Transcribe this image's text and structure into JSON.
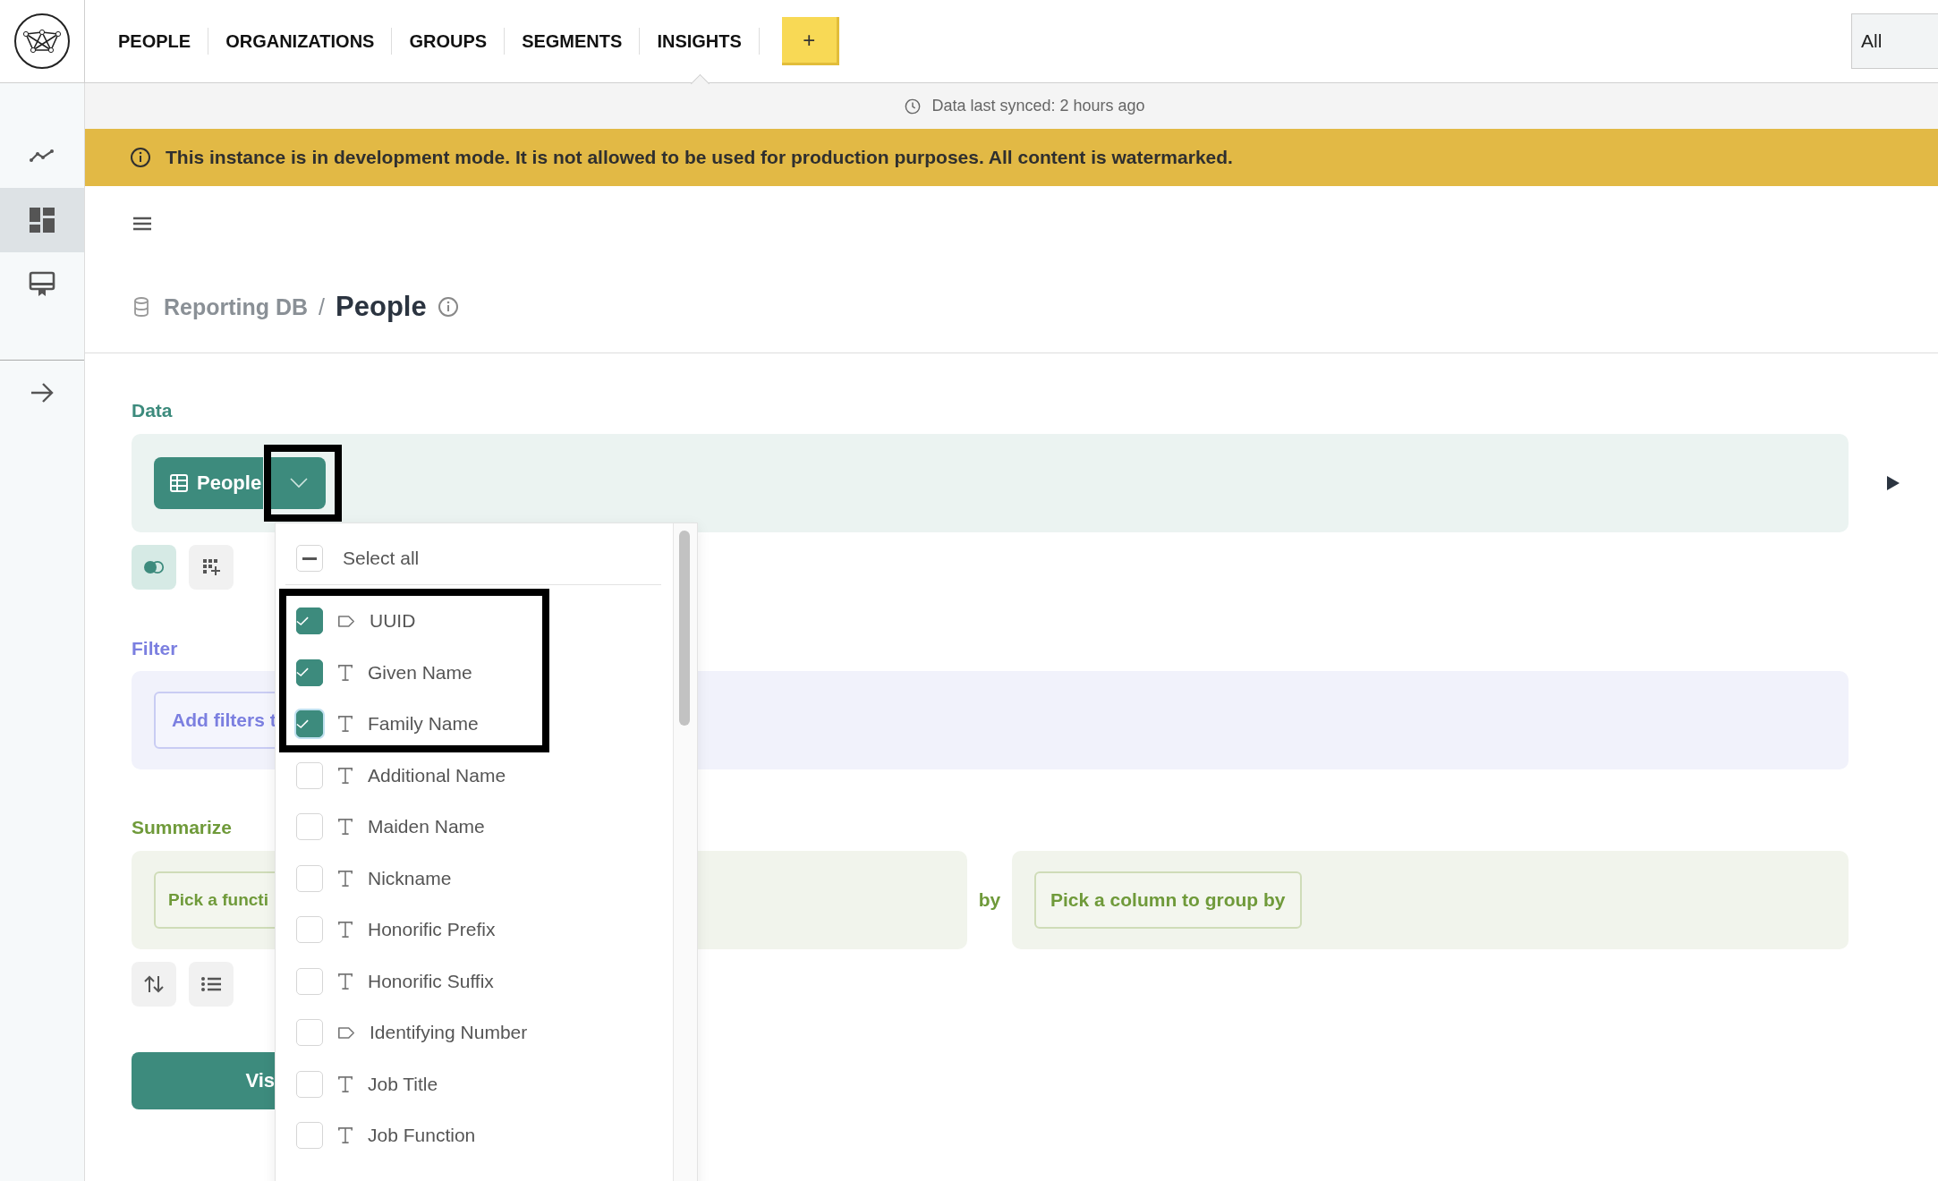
{
  "nav": {
    "tabs": [
      {
        "label": "PEOPLE",
        "selected": false
      },
      {
        "label": "ORGANIZATIONS",
        "selected": false
      },
      {
        "label": "GROUPS",
        "selected": false
      },
      {
        "label": "SEGMENTS",
        "selected": false
      },
      {
        "label": "INSIGHTS",
        "selected": true
      }
    ],
    "add_button": "+",
    "scope_select": {
      "value": "All"
    }
  },
  "sidebar": {
    "items": [
      {
        "kind": "chart",
        "selected": false
      },
      {
        "kind": "dashboard",
        "selected": true
      },
      {
        "kind": "presentation",
        "selected": false
      }
    ]
  },
  "sync_status": "Data last synced: 2 hours ago",
  "banner": "This instance is in development mode. It is not allowed to be used for production purposes. All content is watermarked.",
  "breadcrumb": {
    "parent": "Reporting DB",
    "separator": "/",
    "title": "People"
  },
  "data": {
    "label": "Data",
    "table_button": "People"
  },
  "filter": {
    "label": "Filter",
    "button": "Add filters t"
  },
  "summarize": {
    "label": "Summarize",
    "function_button": "Pick a functi",
    "by": "by",
    "group_button": "Pick a column to group by"
  },
  "visualize_button": "Vis",
  "column_menu": {
    "select_all": {
      "label": "Select all",
      "indeterminate": true
    },
    "columns": [
      {
        "label": "UUID",
        "kind": "id",
        "checked": true,
        "focused": false
      },
      {
        "label": "Given Name",
        "kind": "text",
        "checked": true,
        "focused": false
      },
      {
        "label": "Family Name",
        "kind": "text",
        "checked": true,
        "focused": true
      },
      {
        "label": "Additional Name",
        "kind": "text",
        "checked": false,
        "focused": false
      },
      {
        "label": "Maiden Name",
        "kind": "text",
        "checked": false,
        "focused": false
      },
      {
        "label": "Nickname",
        "kind": "text",
        "checked": false,
        "focused": false
      },
      {
        "label": "Honorific Prefix",
        "kind": "text",
        "checked": false,
        "focused": false
      },
      {
        "label": "Honorific Suffix",
        "kind": "text",
        "checked": false,
        "focused": false
      },
      {
        "label": "Identifying Number",
        "kind": "id",
        "checked": false,
        "focused": false
      },
      {
        "label": "Job Title",
        "kind": "text",
        "checked": false,
        "focused": false
      },
      {
        "label": "Job Function",
        "kind": "text",
        "checked": false,
        "focused": false
      }
    ]
  }
}
